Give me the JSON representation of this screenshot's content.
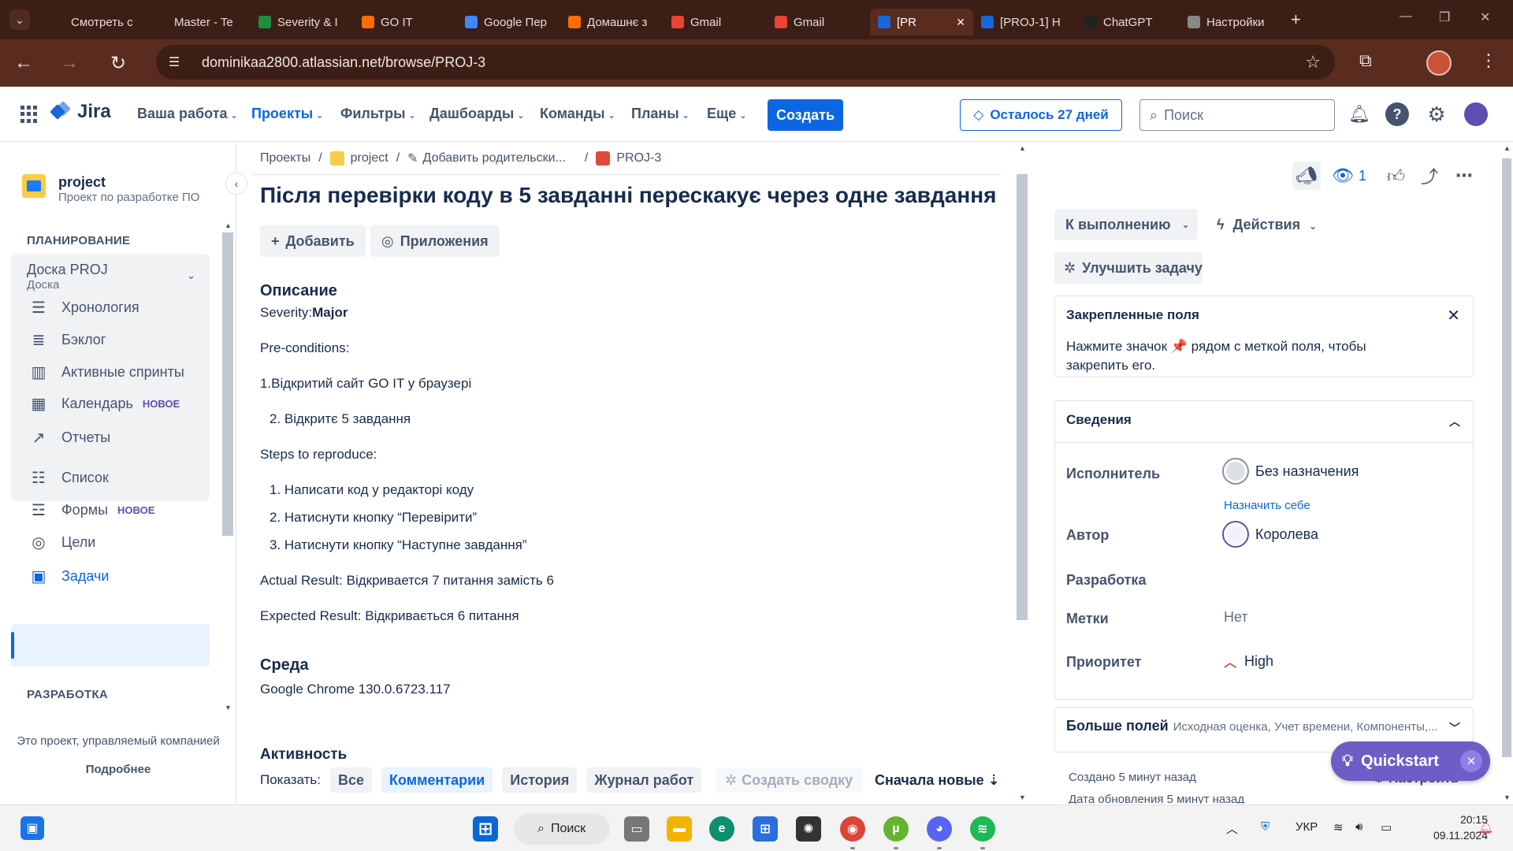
{
  "browser": {
    "tabs": [
      {
        "label": "Смотреть с",
        "icon": "hd-icon",
        "color": "#3b1f17"
      },
      {
        "label": "Master - Te",
        "icon": "globe-icon",
        "color": "#3b1f17"
      },
      {
        "label": "Severity & I",
        "icon": "sheets-icon",
        "color": "#1e8e3e"
      },
      {
        "label": "GO IT",
        "icon": "goit-icon",
        "color": "#ff6d00"
      },
      {
        "label": "Google Пер",
        "icon": "translate-icon",
        "color": "#4285f4"
      },
      {
        "label": "Домашнє з",
        "icon": "goit-icon",
        "color": "#ff6d00"
      },
      {
        "label": "Gmail",
        "icon": "gmail-icon",
        "color": "#ea4335"
      },
      {
        "label": "Gmail",
        "icon": "gmail-icon",
        "color": "#ea4335"
      },
      {
        "label": "[PR",
        "icon": "jira-icon",
        "color": "#1868db",
        "active": true
      },
      {
        "label": "[PROJ-1] H",
        "icon": "jira-icon",
        "color": "#1868db"
      },
      {
        "label": "ChatGPT",
        "icon": "chatgpt-icon",
        "color": "#222222"
      },
      {
        "label": "Настройки",
        "icon": "gear-icon",
        "color": "#888888"
      }
    ],
    "url": "dominikaa2800.atlassian.net/browse/PROJ-3"
  },
  "topnav": {
    "product": "Jira",
    "items": [
      "Ваша работа",
      "Проекты",
      "Фильтры",
      "Дашбоарды",
      "Команды",
      "Планы",
      "Еще"
    ],
    "active_item": "Проекты",
    "create": "Создать",
    "trial": "Осталось 27 дней",
    "search_placeholder": "Поиск"
  },
  "sidebar": {
    "project_name": "project",
    "project_type": "Проект по разработке ПО",
    "planning_header": "ПЛАНИРОВАНИЕ",
    "board_title": "Доска PROJ",
    "board_sub": "Доска",
    "planning_items": [
      {
        "label": "Хронология",
        "icon": "timeline-icon"
      },
      {
        "label": "Бэклог",
        "icon": "backlog-icon"
      },
      {
        "label": "Активные спринты",
        "icon": "board-icon"
      },
      {
        "label": "Календарь",
        "icon": "calendar-icon",
        "badge": "НОВОЕ"
      },
      {
        "label": "Отчеты",
        "icon": "reports-icon"
      }
    ],
    "other_items": [
      {
        "label": "Список",
        "icon": "list-icon"
      },
      {
        "label": "Формы",
        "icon": "forms-icon",
        "badge": "НОВОЕ"
      },
      {
        "label": "Цели",
        "icon": "goals-icon"
      },
      {
        "label": "Задачи",
        "icon": "issues-icon",
        "selected": true
      }
    ],
    "dev_header": "РАЗРАБОТКА",
    "footer_text": "Это проект, управляемый компанией",
    "footer_link": "Подробнее"
  },
  "issue": {
    "breadcrumbs": [
      "Проекты",
      "project",
      "Добавить родительски...",
      "PROJ-3"
    ],
    "title": "Після перевірки коду в 5 завданні перескакує через одне завдання",
    "add_button": "Добавить",
    "apps_button": "Приложения",
    "description_header": "Описание",
    "severity_label": "Severity:",
    "severity_value": "Major",
    "lines": [
      "Pre-conditions:",
      "1.Відкритий сайт GO IT у браузері",
      "2. Відкритє 5 завдання",
      "Steps to reproduce:",
      "1. Написати код у редакторі коду",
      "2. Натиснути кнопку “Перевірити”",
      "3. Натиснути кнопку “Наступне завдання”",
      "Actual Result: Відкривается 7 питання замість 6",
      "Expected Result: Відкривається 6 питання"
    ],
    "environment_header": "Среда",
    "environment_value": "Google Chrome 130.0.6723.117",
    "activity_header": "Активность",
    "show_label": "Показать:",
    "activity_tabs": [
      "Все",
      "Комментарии",
      "История",
      "Журнал работ"
    ],
    "activity_active": "Комментарии",
    "summary_button": "Создать сводку",
    "sort_label": "Сначала новые"
  },
  "panel": {
    "watchers": "1",
    "status": "К выполнению",
    "actions": "Действия",
    "improve": "Улучшить задачу",
    "pinned_header": "Закрепленные поля",
    "pinned_text": "Нажмите значок 📌 рядом с меткой поля, чтобы закрепить его.",
    "details_header": "Сведения",
    "assignee_label": "Исполнитель",
    "assignee_value": "Без назначения",
    "assign_me": "Назначить себе",
    "reporter_label": "Автор",
    "reporter_value": "Королева",
    "development_label": "Разработка",
    "labels_label": "Метки",
    "labels_value": "Нет",
    "priority_label": "Приоритет",
    "priority_value": "High",
    "more_fields_label": "Больше полей",
    "more_fields_hint": "Исходная оценка, Учет времени, Компоненты,...",
    "created": "Создано 5 минут назад",
    "updated": "Дата обновления 5 минут назад",
    "configure": "Настроить",
    "quickstart": "Quickstart"
  },
  "taskbar": {
    "search": "Поиск",
    "lang": "УКР",
    "time": "20:15",
    "date": "09.11.2024"
  },
  "colors": {
    "jira_blue": "#0c66e4",
    "chrome_dark": "#3b1f17",
    "chrome_bar": "#5a2b1f",
    "quickstart": "#6e5dc6",
    "priority_high": "#e2483d"
  }
}
